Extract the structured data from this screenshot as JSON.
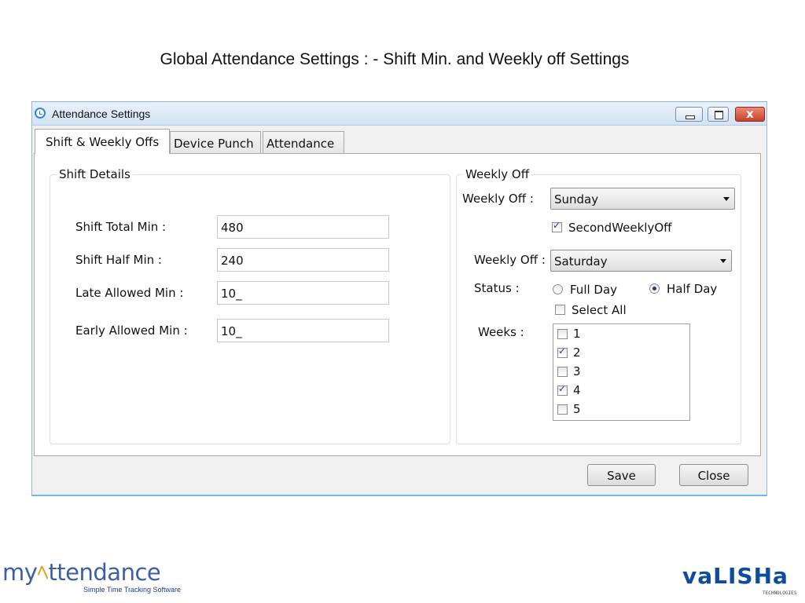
{
  "slide": {
    "title": "Global Attendance Settings : - Shift Min. and Weekly off Settings"
  },
  "window": {
    "title": "Attendance Settings",
    "close_glyph": "x"
  },
  "tabs": [
    {
      "label": "Shift & Weekly Offs",
      "active": true
    },
    {
      "label": "Device Punch",
      "active": false
    },
    {
      "label": "Attendance",
      "active": false
    }
  ],
  "shift_details": {
    "legend": "Shift Details",
    "fields": [
      {
        "label": "Shift Total Min :",
        "value": "480"
      },
      {
        "label": "Shift Half Min :",
        "value": "240"
      },
      {
        "label": "Late Allowed Min :",
        "value": "10_"
      },
      {
        "label": "Early Allowed Min :",
        "value": "10_"
      }
    ]
  },
  "weekly_off": {
    "legend": "Weekly Off",
    "first_label": "Weekly Off :",
    "first_value": "Sunday",
    "second_weekly_off": {
      "label": "SecondWeeklyOff",
      "checked": true
    },
    "second_label": "Weekly Off :",
    "second_value": "Saturday",
    "status_label": "Status :",
    "status_options": [
      {
        "label": "Full Day",
        "selected": false
      },
      {
        "label": "Half Day",
        "selected": true
      }
    ],
    "select_all": {
      "label": "Select All",
      "checked": false
    },
    "weeks_label": "Weeks :",
    "weeks": [
      {
        "label": "1",
        "checked": false
      },
      {
        "label": "2",
        "checked": true
      },
      {
        "label": "3",
        "checked": false
      },
      {
        "label": "4",
        "checked": true
      },
      {
        "label": "5",
        "checked": false
      }
    ]
  },
  "buttons": {
    "save": "Save",
    "close": "Close"
  },
  "footer": {
    "brand_left_prefix": "my",
    "brand_left_bell": "ﾍ",
    "brand_left_suffix": "ttendance",
    "brand_left_tagline": "Simple Time Tracking Software",
    "brand_right": "vaLISHa",
    "brand_right_sub": "TECHNOLOGIES"
  },
  "colors": {
    "accent_blue": "#2a8ae0",
    "brand_blue": "#0e4d9c",
    "brand_gold": "#e0a21b",
    "close_red": "#c8422a"
  }
}
